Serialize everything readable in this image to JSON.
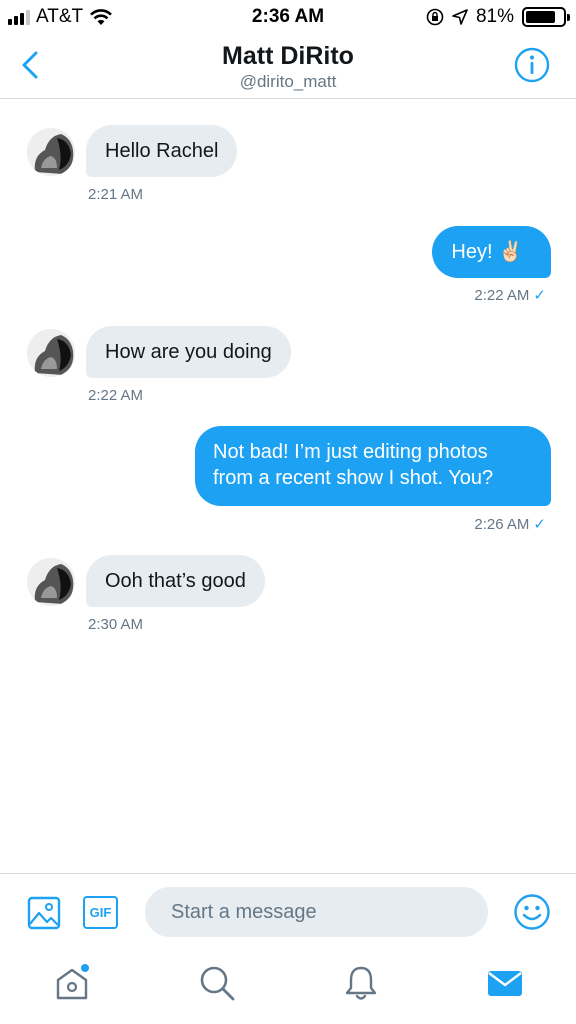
{
  "status_bar": {
    "carrier": "AT&T",
    "time": "2:36 AM",
    "battery": "81%",
    "battery_level": 0.81
  },
  "header": {
    "title": "Matt DiRito",
    "subtitle": "@dirito_matt",
    "back_icon": "chevron-left-icon",
    "info_icon": "info-icon"
  },
  "messages": [
    {
      "direction": "incoming",
      "text": "Hello Rachel",
      "time": "2:21 AM"
    },
    {
      "direction": "outgoing",
      "text": "Hey! ✌🏻",
      "time": "2:22 AM"
    },
    {
      "direction": "incoming",
      "text": "How are you doing",
      "time": "2:22 AM"
    },
    {
      "direction": "outgoing",
      "lines": [
        "Not bad! I’m just editing photos",
        "from a recent show I shot. You?"
      ],
      "time": "2:26 AM"
    },
    {
      "direction": "incoming",
      "text": "Ooh that’s good",
      "time": "2:30 AM"
    }
  ],
  "read_mark": "✓",
  "composer": {
    "placeholder": "Start a message",
    "gif_label": "GIF"
  },
  "colors": {
    "accent": "#1da1f2",
    "bubble_incoming": "#e6ecf0",
    "secondary_text": "#657786"
  },
  "tab_bar": [
    "home-icon",
    "search-icon",
    "notifications-icon",
    "messages-icon"
  ]
}
